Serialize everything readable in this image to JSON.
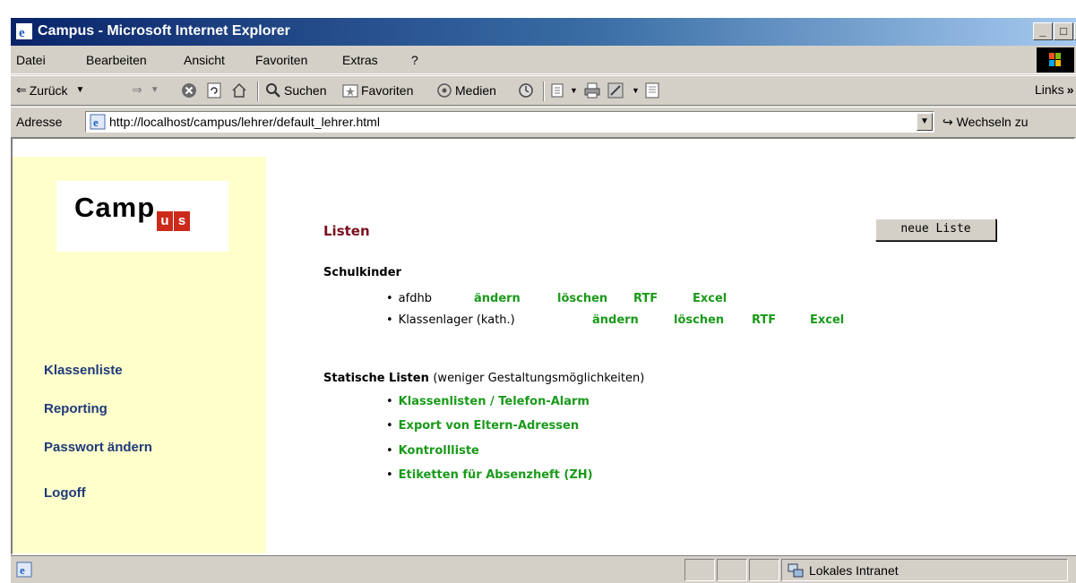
{
  "window": {
    "title": "Campus - Microsoft Internet Explorer",
    "minimize": "_",
    "maximize": "□",
    "close": "×"
  },
  "menu": {
    "items": [
      "Datei",
      "Bearbeiten",
      "Ansicht",
      "Favoriten",
      "Extras",
      "?"
    ]
  },
  "toolbar": {
    "back": "Zurück",
    "search": "Suchen",
    "favorites": "Favoriten",
    "media": "Medien",
    "links": "Links",
    "chevron": "»"
  },
  "address": {
    "label": "Adresse",
    "url": "http://localhost/campus/lehrer/default_lehrer.html",
    "go": "Wechseln zu"
  },
  "logo": {
    "text": "Camp",
    "u": "u",
    "s": "s"
  },
  "sidebar": {
    "links": [
      "Klassenliste",
      "Reporting",
      "Passwort ändern",
      "Logoff"
    ]
  },
  "main": {
    "title": "Listen",
    "new_button": "neue Liste",
    "schulkinder_title": "Schulkinder",
    "lists": [
      {
        "name": "afdhb",
        "edit": "ändern",
        "delete": "löschen",
        "rtf": "RTF",
        "excel": "Excel"
      },
      {
        "name": "Klassenlager (kath.)",
        "edit": "ändern",
        "delete": "löschen",
        "rtf": "RTF",
        "excel": "Excel"
      }
    ],
    "static_title": "Statische Listen",
    "static_note": "(weniger Gestaltungsmöglichkeiten)",
    "static_links": [
      "Klassenlisten / Telefon-Alarm",
      "Export von Eltern-Adressen",
      "Kontrollliste",
      "Etiketten für Absenzheft (ZH)"
    ]
  },
  "status": {
    "zone": "Lokales Intranet"
  }
}
